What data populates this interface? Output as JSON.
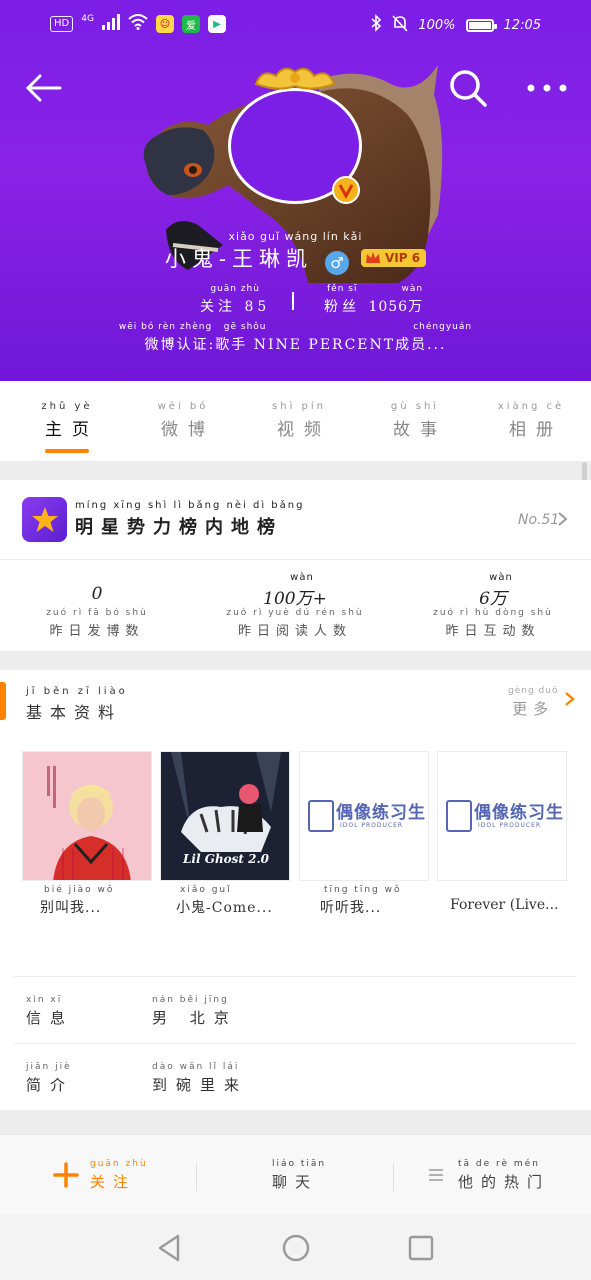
{
  "status_bar": {
    "hd": "HD",
    "network": "4G",
    "battery": "100%",
    "time": "12:05",
    "battery_level": 1.0
  },
  "profile": {
    "name_pinyin": "xiǎo guǐ wáng lín kǎi",
    "name": "小鬼-王琳凯",
    "gender_symbol": "♂",
    "vip_label": "VIP 6",
    "following": {
      "pinyin": "guān zhù",
      "label": "关注",
      "value": "85"
    },
    "followers": {
      "pinyin": "fěn sī",
      "label": "粉丝",
      "value": "1056",
      "unit_pinyin": "wàn",
      "unit": "万"
    },
    "verify_pinyin": "wēi bó rèn zhèng   gē shǒu                                      chéngyuán",
    "verify_text": "微博认证:歌手 NINE PERCENT成员..."
  },
  "tabs": [
    {
      "pinyin": "zhǔ yè",
      "label": "主页",
      "active": true
    },
    {
      "pinyin": "wēi bó",
      "label": "微博",
      "active": false
    },
    {
      "pinyin": "shì pín",
      "label": "视频",
      "active": false
    },
    {
      "pinyin": "gù shì",
      "label": "故事",
      "active": false
    },
    {
      "pinyin": "xiàng cè",
      "label": "相册",
      "active": false
    }
  ],
  "rank": {
    "pinyin": "míng xīng shì lì bǎng nèi dì bǎng",
    "title": "明星势力榜内地榜",
    "no": "No.51"
  },
  "metrics": [
    {
      "value_pinyin": "",
      "value": "0",
      "pinyin": "zuó rì fā bó shù",
      "label": "昨日发博数"
    },
    {
      "value_pinyin": "wàn",
      "value": "100万+",
      "pinyin": "zuó rì yuè dú rén shù",
      "label": "昨日阅读人数"
    },
    {
      "value_pinyin": "wàn",
      "value": "6万",
      "pinyin": "zuó rì hù dòng shù",
      "label": "昨日互动数"
    }
  ],
  "basic": {
    "pinyin": "jī běn zī liào",
    "title": "基本资料",
    "more_pinyin": "gèng duō",
    "more": "更多",
    "albums": [
      {
        "pinyin": "bié jiào wǒ",
        "caption": "别叫我..."
      },
      {
        "pinyin": "xiǎo guǐ",
        "caption": "小鬼-Come...",
        "cover_text": "Lil Ghost 2.0"
      },
      {
        "pinyin": "tīng tīng wǒ",
        "caption": "听听我...",
        "cover_text": "偶像练习生",
        "cover_sub": "IDOL PRODUCER"
      },
      {
        "pinyin": "",
        "caption": "Forever (Live...",
        "cover_text": "偶像练习生",
        "cover_sub": "IDOL PRODUCER"
      }
    ],
    "rows": [
      {
        "label_pinyin": "xìn xī",
        "label": "信息",
        "value_pinyin": "nán běi jīng",
        "value": "男 北京"
      },
      {
        "label_pinyin": "jiǎn jiè",
        "label": "简介",
        "value_pinyin": "dào wǎn lǐ lái",
        "value": "到碗里来"
      }
    ]
  },
  "actions": {
    "follow_pinyin": "guān zhù",
    "follow": "关注",
    "chat_pinyin": "liáo tiān",
    "chat": "聊天",
    "hot_pinyin": "tā de rè mén",
    "hot": "他的热门"
  },
  "colors": {
    "header": "#7b1ee6",
    "accent": "#ff8200",
    "vip": "#f3c832",
    "gender": "#57a8ea"
  }
}
